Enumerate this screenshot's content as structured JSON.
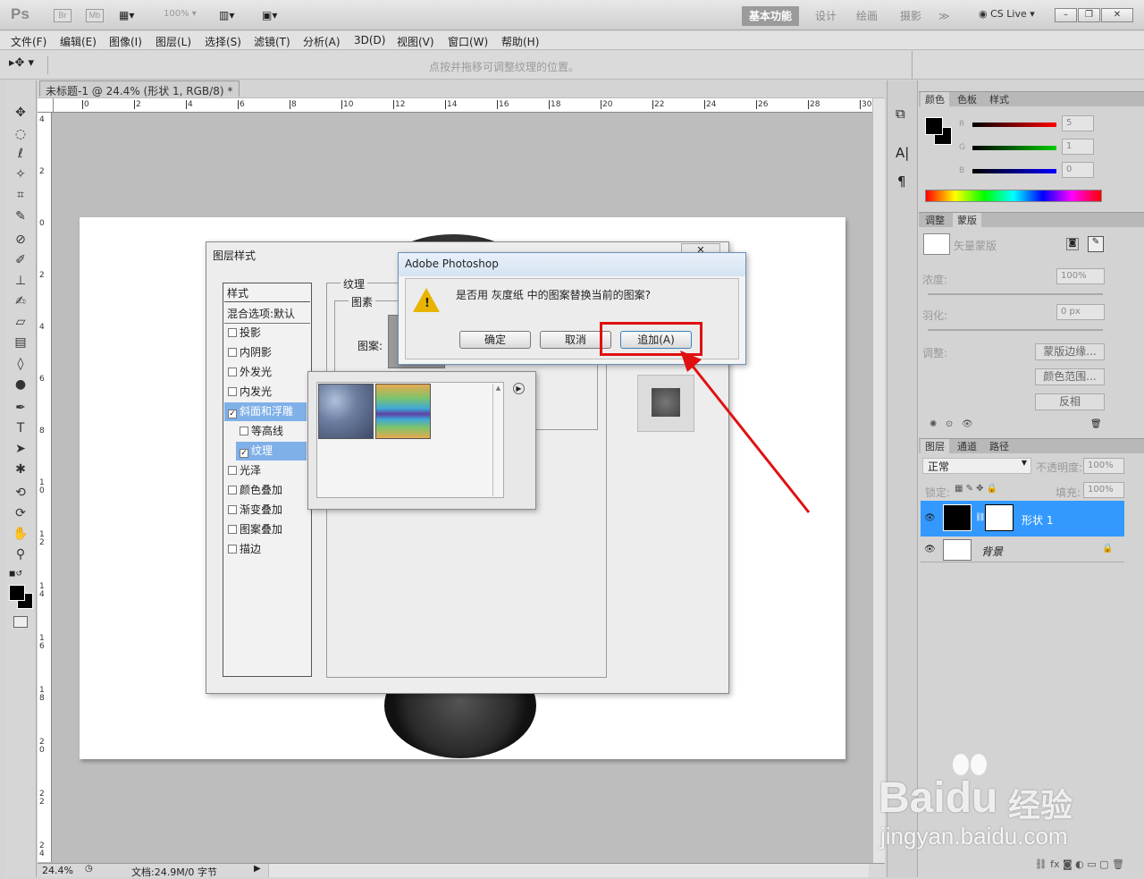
{
  "app": {
    "logo": "Ps",
    "bridge": "Br",
    "minibridge": "Mb",
    "zoom": "100%",
    "workspaces": [
      "基本功能",
      "设计",
      "绘画",
      "摄影"
    ],
    "active_workspace": "基本功能",
    "more": "≫",
    "cslive": "CS Live",
    "accent": "#3399ff"
  },
  "menu": [
    "文件(F)",
    "编辑(E)",
    "图像(I)",
    "图层(L)",
    "选择(S)",
    "滤镜(T)",
    "分析(A)",
    "3D(D)",
    "视图(V)",
    "窗口(W)",
    "帮助(H)"
  ],
  "options_hint": "点按并拖移可调整纹理的位置。",
  "document": {
    "tab_title": "未标题-1 @ 24.4% (形状 1, RGB/8) *",
    "close": "✕",
    "zoom": "24.4%",
    "doc_info": "文档:24.9M/0 字节"
  },
  "rulers": {
    "h": [
      "0",
      "2",
      "4",
      "6",
      "8",
      "10",
      "12",
      "14",
      "16",
      "18",
      "20",
      "22",
      "24",
      "26",
      "28",
      "30"
    ],
    "v": [
      "4",
      "2",
      "0",
      "2",
      "4",
      "6",
      "8",
      "1\n0",
      "1\n2",
      "1\n4",
      "1\n6",
      "1\n8",
      "2\n0",
      "2\n2",
      "2\n4"
    ]
  },
  "layer_style_dialog": {
    "title": "图层样式",
    "styles_header": "样式",
    "blend_options": "混合选项:默认",
    "items": [
      {
        "label": "投影",
        "checked": false
      },
      {
        "label": "内阴影",
        "checked": false
      },
      {
        "label": "外发光",
        "checked": false
      },
      {
        "label": "内发光",
        "checked": false
      },
      {
        "label": "斜面和浮雕",
        "checked": true,
        "selected": true
      },
      {
        "label": "等高线",
        "checked": false,
        "sub": true
      },
      {
        "label": "纹理",
        "checked": true,
        "sub": true,
        "selected": true
      },
      {
        "label": "光泽",
        "checked": false
      },
      {
        "label": "颜色叠加",
        "checked": false
      },
      {
        "label": "渐变叠加",
        "checked": false
      },
      {
        "label": "图案叠加",
        "checked": false
      },
      {
        "label": "描边",
        "checked": false
      }
    ],
    "group_texture": "纹理",
    "group_pattern": "图素",
    "pattern_label": "图案:",
    "close": "✕"
  },
  "alert": {
    "title": "Adobe Photoshop",
    "message": "是否用 灰度纸 中的图案替换当前的图案?",
    "ok": "确定",
    "cancel": "取消",
    "append": "追加(A)"
  },
  "panels": {
    "color_tabs": [
      "颜色",
      "色板",
      "样式"
    ],
    "rgb": [
      {
        "label": "R",
        "value": "5"
      },
      {
        "label": "G",
        "value": "1"
      },
      {
        "label": "B",
        "value": "0"
      }
    ],
    "adjust_tabs": [
      "调整",
      "蒙版"
    ],
    "vector_mask": "矢量蒙版",
    "density_label": "浓度:",
    "density_value": "100%",
    "feather_label": "羽化:",
    "feather_value": "0 px",
    "refine_label": "调整:",
    "mask_edge": "蒙版边缘...",
    "color_range": "颜色范围...",
    "invert": "反相",
    "layers_tabs": [
      "图层",
      "通道",
      "路径"
    ],
    "blend_mode": "正常",
    "opacity_label": "不透明度:",
    "opacity_value": "100%",
    "lock_label": "锁定:",
    "fill_label": "填充:",
    "fill_value": "100%",
    "layers": [
      {
        "name": "形状 1",
        "selected": true
      },
      {
        "name": "背景",
        "locked": true
      }
    ]
  },
  "watermark": {
    "brand": "Baidu",
    "brand_cn": "经验",
    "url": "jingyan.baidu.com"
  }
}
